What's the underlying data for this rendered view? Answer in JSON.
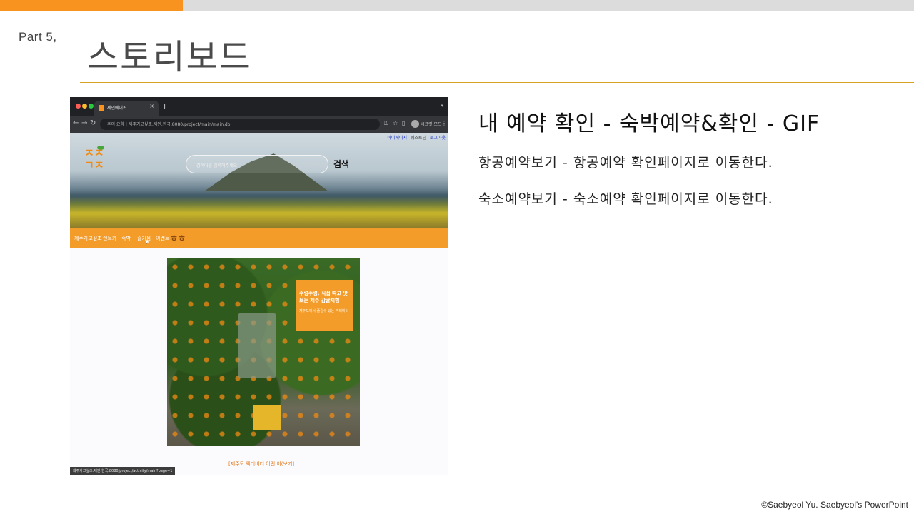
{
  "slide": {
    "part_label": "Part  5,",
    "title": "스토리보드",
    "accent_color": "#f7931e",
    "rule_color": "#d9a322"
  },
  "description": {
    "heading": "내 예약 확인 - 숙박예약&확인 - GIF",
    "lines": [
      "항공예약보기 - 항공예약 확인페이지로 이동한다.",
      "숙소예약보기 - 숙소예약 확인페이지로 이동한다."
    ]
  },
  "footer": {
    "copyright": "©Saebyeol Yu. Saebyeol's PowerPoint"
  },
  "browser": {
    "tab_title": "제인에어커",
    "tab_close": "×",
    "new_tab": "+",
    "url": "주의 요함 | 제주가고싶조.제인.한국:8080/project/main/main.do",
    "profile_label": "시크릿 모드",
    "icons": [
      "back-icon",
      "forward-icon",
      "reload-icon",
      "lock-icon",
      "star-icon"
    ],
    "site": {
      "util_links": [
        "마이페이지",
        "워스트님",
        "로그아웃"
      ],
      "logo_text": "ㅈㅈ\nㄱㅈ",
      "search_placeholder": "검색어를 입력해주세요",
      "search_button": "검색",
      "nav_items": [
        "제주가고싶조",
        "렌트카",
        "숙박",
        "즐거움",
        "이벤트"
      ],
      "nav_logo": "ㅎㅎ",
      "promo_title": "주렁주렁, 직접 따고 맛보는 제주 감귤체험",
      "promo_subtitle": "제주도에서 즐길수 있는 액티비티",
      "more_link": "[제주도 액티비티 어떤 이(보기]",
      "status_url": "제주가고싶조.제인.한국:8080/project/activity/main?page=1",
      "brand_color": "#f39c2a"
    }
  }
}
